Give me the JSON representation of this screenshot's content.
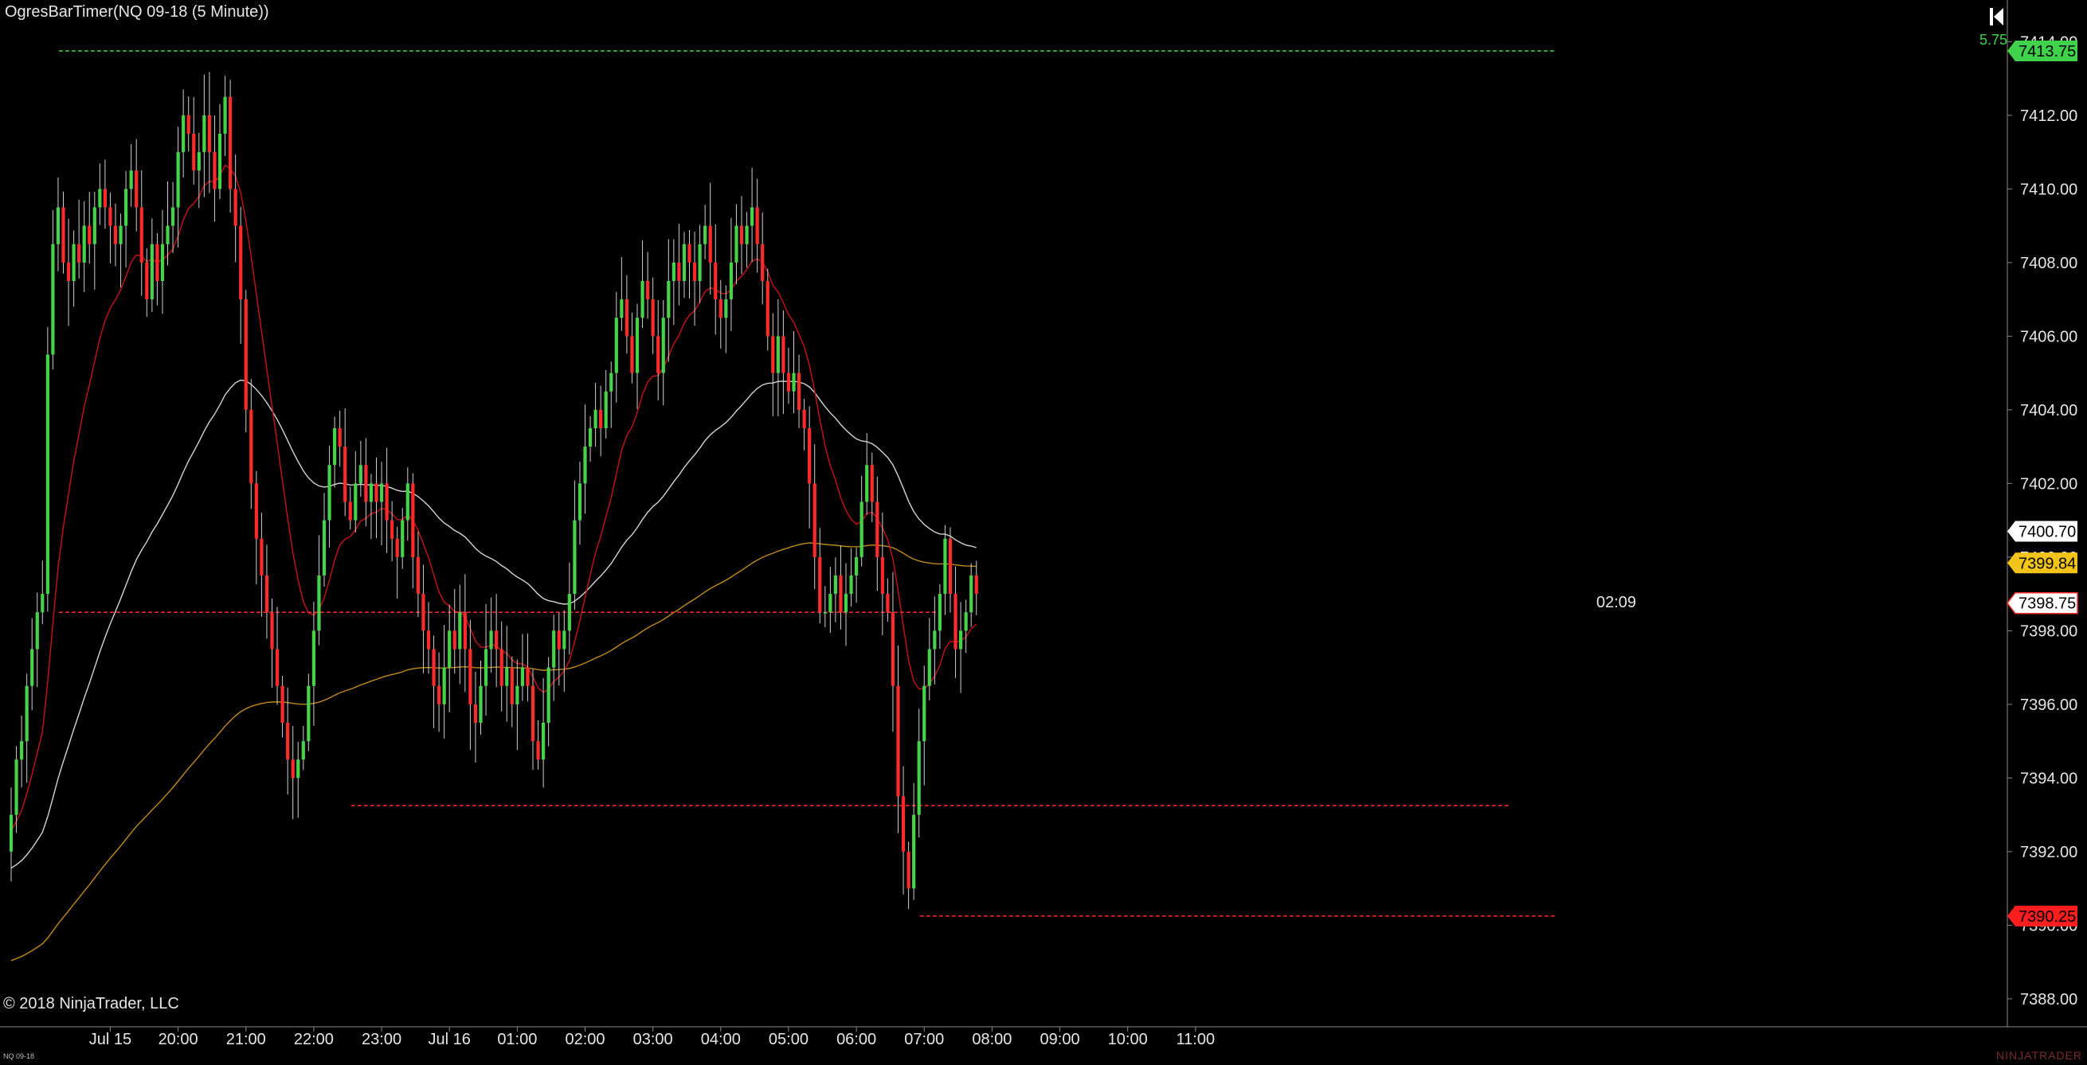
{
  "title": "OgresBarTimer(NQ 09-18 (5 Minute))",
  "copyright": "© 2018 NinjaTrader, LLC",
  "tab_label": "NQ 09-18",
  "brand": "NINJATRADER",
  "tick_count": "5.75",
  "bar_timer": "02:09",
  "colors": {
    "background": "#000000",
    "up": "#46d34a",
    "down": "#ff2b2b",
    "ema_fast": "#c81414",
    "ema_slow": "#d4d4d4",
    "ema_long": "#c08a1a",
    "last_price_bg": "#ffffff",
    "accent_green": "#3fd24a",
    "accent_yellow": "#f2c318",
    "accent_red": "#ff1e1e"
  },
  "chart_data": {
    "type": "candlestick",
    "ylim": [
      7387.5,
      7414.7
    ],
    "y_ticks": [
      "7388.00",
      "7390.00",
      "7392.00",
      "7394.00",
      "7396.00",
      "7398.00",
      "7400.00",
      "7402.00",
      "7404.00",
      "7406.00",
      "7408.00",
      "7410.00",
      "7412.00",
      "7414.00"
    ],
    "x_ticks": [
      {
        "label": "Jul 15",
        "bar": 19
      },
      {
        "label": "20:00",
        "bar": 32
      },
      {
        "label": "21:00",
        "bar": 45
      },
      {
        "label": "22:00",
        "bar": 58
      },
      {
        "label": "23:00",
        "bar": 71
      },
      {
        "label": "Jul 16",
        "bar": 84
      },
      {
        "label": "01:00",
        "bar": 97
      },
      {
        "label": "02:00",
        "bar": 110
      },
      {
        "label": "03:00",
        "bar": 123
      },
      {
        "label": "04:00",
        "bar": 136
      },
      {
        "label": "05:00",
        "bar": 149
      },
      {
        "label": "06:00",
        "bar": 162
      },
      {
        "label": "07:00",
        "bar": 175
      },
      {
        "label": "08:00",
        "bar": 188
      },
      {
        "label": "09:00",
        "bar": 201
      },
      {
        "label": "10:00",
        "bar": 214
      },
      {
        "label": "11:00",
        "bar": 227
      }
    ],
    "bar_spacing_px": 6.55,
    "close_path": [
      7393,
      7394.5,
      7395,
      7396.5,
      7397.5,
      7398.5,
      7399,
      7405.5,
      7408.5,
      7409.5,
      7408,
      7407.5,
      7408.5,
      7408,
      7409,
      7408.5,
      7409.5,
      7410,
      7409.5,
      7409,
      7408.5,
      7409,
      7410,
      7410.5,
      7409.5,
      7408,
      7407,
      7408.5,
      7407.5,
      7408.5,
      7409,
      7409.5,
      7411,
      7412,
      7411.5,
      7410.5,
      7411,
      7412,
      7411,
      7410,
      7411.5,
      7412.5,
      7410,
      7409,
      7407,
      7404,
      7402,
      7400.5,
      7399.5,
      7398.5,
      7397.5,
      7396.5,
      7395.5,
      7394.5,
      7394,
      7394.5,
      7395,
      7396.5,
      7398,
      7399.5,
      7401,
      7402.5,
      7403.5,
      7403,
      7401.5,
      7401,
      7402,
      7402.5,
      7401.5,
      7402,
      7401.5,
      7402,
      7401,
      7400.5,
      7400,
      7401,
      7402,
      7400,
      7399,
      7398,
      7397.5,
      7396.5,
      7396,
      7397,
      7398,
      7397.5,
      7398.5,
      7397.5,
      7396,
      7395.5,
      7396.5,
      7397.5,
      7398,
      7397.5,
      7396.5,
      7397,
      7396,
      7396.5,
      7397,
      7396.5,
      7395,
      7394.5,
      7395.5,
      7397,
      7398,
      7397.5,
      7398,
      7399,
      7401,
      7402,
      7403,
      7403.5,
      7404,
      7403.5,
      7404.5,
      7405,
      7406.5,
      7407,
      7406,
      7405,
      7406.5,
      7407.5,
      7407,
      7406,
      7405,
      7406.5,
      7407.5,
      7408,
      7407.5,
      7408.5,
      7408,
      7407.5,
      7408.5,
      7409,
      7408,
      7407,
      7406.5,
      7407,
      7408,
      7409,
      7408.5,
      7409,
      7409.5,
      7408.5,
      7407.5,
      7406,
      7405,
      7406,
      7405,
      7404.5,
      7405,
      7404,
      7403.5,
      7402,
      7400,
      7398.5,
      7398.5,
      7399,
      7399.5,
      7398.5,
      7399,
      7399.5,
      7400,
      7401.5,
      7402.5,
      7401.5,
      7400,
      7399,
      7398.5,
      7396.5,
      7393.5,
      7392,
      7391,
      7393,
      7395,
      7396.5,
      7397.5,
      7398,
      7399,
      7400.5,
      7399,
      7397.5,
      7398,
      7398.5,
      7399.5,
      7399
    ],
    "levels": [
      {
        "name": "session-high",
        "value": 7413.75,
        "label": "7413.75",
        "color": "#3fd24a"
      },
      {
        "name": "ema-slow",
        "value": 7400.7,
        "label": "7400.70",
        "color": "#ffffff"
      },
      {
        "name": "ema-long",
        "value": 7399.84,
        "label": "7399.84",
        "color": "#f2c318"
      },
      {
        "name": "last-price",
        "value": 7398.75,
        "label": "7398.75",
        "color": "#ffffff"
      },
      {
        "name": "session-low",
        "value": 7390.25,
        "label": "7390.25",
        "color": "#ff1e1e"
      }
    ],
    "swing_lines": [
      {
        "from_bar": 0,
        "to_bar": 174,
        "value": 7413.75,
        "style": "green-dashed"
      },
      {
        "from_bar": 0,
        "to_bar": 56,
        "value": 7398.5,
        "style": "red-dashed"
      },
      {
        "from_bar": 56,
        "to_bar": 165,
        "value": 7393.25,
        "style": "red-dashed"
      },
      {
        "from_bar": 165,
        "to_bar": 174,
        "value": 7390.25,
        "style": "red-dashed"
      }
    ]
  }
}
